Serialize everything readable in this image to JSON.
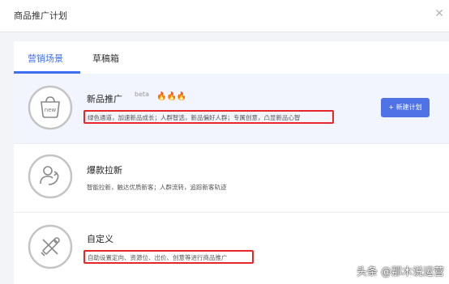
{
  "window": {
    "title": "商品推广计划",
    "close_icon": "close-icon"
  },
  "tabs": [
    {
      "label": "营销场景",
      "active": true
    },
    {
      "label": "草稿箱",
      "active": false
    }
  ],
  "scenes": [
    {
      "title": "新品推广",
      "tag": "beta",
      "hot_count": 3,
      "description": "绿色通道，加速新品成长；人群智选，新品偏好人群；专属创意，凸显新品心智",
      "icon": "new-bag-icon",
      "icon_text": "new",
      "highlighted": true,
      "button_label": "+ 新建计划"
    },
    {
      "title": "爆款拉新",
      "description": "智能拉新，触达优质新客；人群流转，追踪新客轨迹",
      "icon": "user-growth-icon",
      "highlighted": false
    },
    {
      "title": "自定义",
      "description": "自助设置定向、资源位、出价、创意等进行商品推广",
      "icon": "tools-icon",
      "highlighted": false
    }
  ],
  "watermark": "头条 @那木说运营",
  "colors": {
    "accent": "#3d6ef3",
    "button": "#4f73e6",
    "highlight_box": "#e8262a",
    "flame": "#ff5a1f"
  }
}
